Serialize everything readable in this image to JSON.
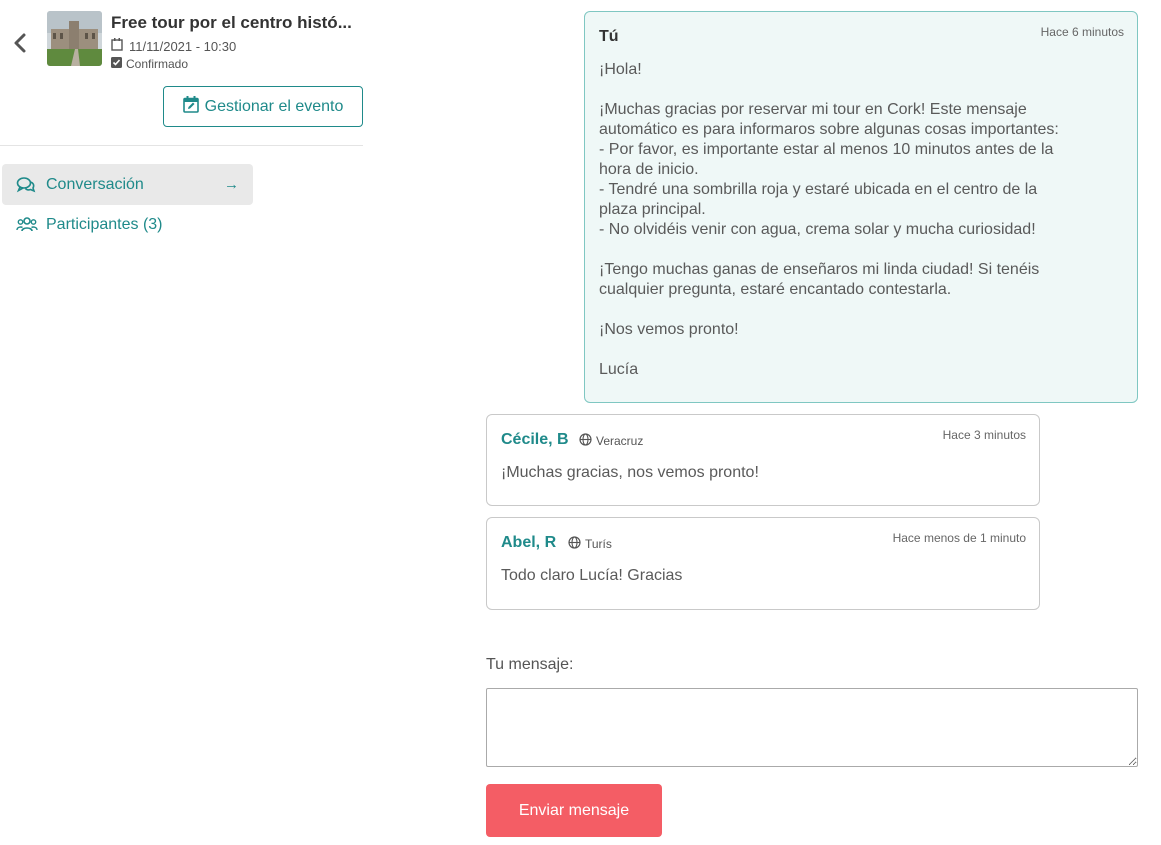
{
  "event": {
    "title": "Free tour por el centro histó...",
    "date": "11/11/2021 - 10:30",
    "status": "Confirmado",
    "manage_label": "Gestionar el evento"
  },
  "nav": {
    "items": [
      {
        "label": "Conversación",
        "icon": "chat-icon",
        "active": true
      },
      {
        "label": "Participantes (3)",
        "icon": "users-icon",
        "active": false
      }
    ],
    "arrow": "→"
  },
  "messages": [
    {
      "author": "Tú",
      "location": "",
      "time": "Hace 6 minutos",
      "body": "¡Hola!\n\n¡Muchas gracias por reservar mi tour en Cork! Este mensaje\nautomático es para informaros sobre algunas cosas importantes:\n- Por favor, es importante estar al menos 10 minutos antes de la\nhora de inicio.\n- Tendré una sombrilla roja y estaré ubicada en el centro de la\nplaza principal.\n- No olvidéis venir con agua, crema solar y mucha curiosidad!\n\n¡Tengo muchas ganas de enseñaros mi linda ciudad! Si tenéis\ncualquier pregunta, estaré encantado contestarla.\n\n¡Nos vemos pronto!\n\nLucía"
    },
    {
      "author": "Cécile, B",
      "location": "Veracruz",
      "time": "Hace 3 minutos",
      "body": "¡Muchas gracias, nos vemos pronto!"
    },
    {
      "author": "Abel, R",
      "location": "Turís",
      "time": "Hace menos de 1 minuto",
      "body": "Todo claro Lucía! Gracias"
    }
  ],
  "compose": {
    "label": "Tu mensaje:",
    "value": "",
    "send_label": "Enviar mensaje"
  },
  "colors": {
    "accent": "#1f8a8a",
    "send_button": "#f45d65",
    "own_message_bg": "#eff8f7"
  }
}
